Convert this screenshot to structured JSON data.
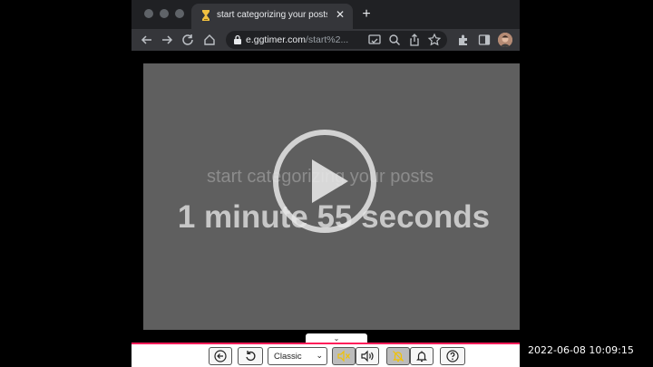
{
  "browser": {
    "tab": {
      "title": "start categorizing your posts"
    },
    "address_bar": {
      "url_host": "e.ggtimer.com",
      "url_path": "/start%2..."
    }
  },
  "timer": {
    "title": "start categorizing your posts",
    "remaining": "1 minute 55 seconds",
    "state": "paused"
  },
  "controls": {
    "theme_select": {
      "value": "Classic",
      "options": [
        "Classic"
      ]
    },
    "mute_active": true,
    "bell_off_active": true
  },
  "recording": {
    "timestamp": "2022-06-08  10:09:15"
  },
  "colors": {
    "accent": "#ff1d5a",
    "panel": "#5f5f5f",
    "timer_text": "#c7c7c7"
  },
  "icons": [
    "back-icon",
    "forward-icon",
    "reload-icon",
    "home-icon",
    "lock-icon",
    "cast-icon",
    "zoom-icon",
    "share-icon",
    "star-icon",
    "extensions-icon",
    "sidebar-icon",
    "play-icon",
    "restart-icon",
    "volume-off-icon",
    "volume-on-icon",
    "bell-off-icon",
    "bell-icon",
    "help-icon"
  ]
}
